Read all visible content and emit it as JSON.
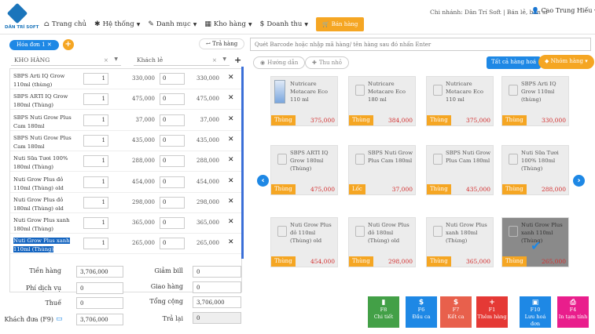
{
  "logo": {
    "text": "DÂN TRÍ SOFT"
  },
  "nav": [
    {
      "icon": "home-icon",
      "glyph": "⌂",
      "label": "Trang chủ",
      "caret": false
    },
    {
      "icon": "gear-icon",
      "glyph": "✱",
      "label": "Hệ thống",
      "caret": true
    },
    {
      "icon": "wrench-icon",
      "glyph": "✎",
      "label": "Danh mục",
      "caret": true
    },
    {
      "icon": "warehouse-icon",
      "glyph": "▦",
      "label": "Kho hàng",
      "caret": true
    },
    {
      "icon": "dollar-icon",
      "glyph": "$",
      "label": "Doanh thu",
      "caret": true
    }
  ],
  "sale_button": "Bán hàng",
  "branch": "Chi nhánh: Dân Trí Soft | Bán lẻ, bán sỉ",
  "user": "Cao Trung Hiếu",
  "order_tab": "Hóa đơn 1",
  "return_button": "Trả hàng",
  "warehouse_select": "KHO HÀNG",
  "customer_select": "Khách lẻ",
  "cart": [
    {
      "name": "SBPS Arti IQ Grow 110ml (thùng)",
      "qty": "1",
      "price": "330,000",
      "discount": "0",
      "total": "330,000"
    },
    {
      "name": "SBPS ARTI IQ Grow 180ml (Thùng)",
      "qty": "1",
      "price": "475,000",
      "discount": "0",
      "total": "475,000"
    },
    {
      "name": "SBPS Nuti Grow Plus Cam 180ml",
      "qty": "1",
      "price": "37,000",
      "discount": "0",
      "total": "37,000"
    },
    {
      "name": "SBPS Nuti Grow Plus Cam 180ml",
      "qty": "1",
      "price": "435,000",
      "discount": "0",
      "total": "435,000"
    },
    {
      "name": "Nuti Sữa Tươi 100% 180ml (Thùng)",
      "qty": "1",
      "price": "288,000",
      "discount": "0",
      "total": "288,000"
    },
    {
      "name": "Nuti Grow Plus đỏ 110ml (Thùng) old",
      "qty": "1",
      "price": "454,000",
      "discount": "0",
      "total": "454,000"
    },
    {
      "name": "Nuti Grow Plus đỏ 180ml (Thùng) old",
      "qty": "1",
      "price": "298,000",
      "discount": "0",
      "total": "298,000"
    },
    {
      "name": "Nuti Grow Plus xanh 180ml (Thùng)",
      "qty": "1",
      "price": "365,000",
      "discount": "0",
      "total": "365,000"
    },
    {
      "name": "Nuti Grow Plus xanh 110ml (Thùng)",
      "qty": "1",
      "price": "265,000",
      "discount": "0",
      "total": "265,000"
    }
  ],
  "summary": {
    "subtotal_label": "Tiền hàng",
    "subtotal": "3,706,000",
    "service_label": "Phí dịch vụ",
    "service": "0",
    "tax_label": "Thuế",
    "tax": "0",
    "paid_label": "Khách đưa (F9)",
    "paid": "3,706,000",
    "bill_discount_label": "Giảm bill",
    "bill_discount": "0",
    "delivery_label": "Giao hàng",
    "delivery": "0",
    "grand_total_label": "Tổng cộng",
    "grand_total": "3,706,000",
    "change_label": "Trả lại",
    "change": "0"
  },
  "search_placeholder": "Quét Barcode hoặc nhập mã hàng/ tên hàng sau đó nhấn Enter",
  "guide_button": "Hướng dẫn",
  "shrink_button": "Thu nhỏ",
  "all_products_button": "Tất cả hàng hoá",
  "product_group_button": "Nhóm hàng",
  "products": [
    {
      "name": "Nutricare Metacare Eco 110 ml",
      "unit": "Thùng",
      "price": "375,000",
      "image": true
    },
    {
      "name": "Nutricare Metacare Eco 180 ml",
      "unit": "Thùng",
      "price": "384,000"
    },
    {
      "name": "Nutricare Metacare Eco 110 ml",
      "unit": "Thùng",
      "price": "375,000"
    },
    {
      "name": "SBPS Arti IQ Grow 110ml (thùng)",
      "unit": "Thùng",
      "price": "330,000"
    },
    {
      "name": "SBPS ARTI IQ Grow 180ml (Thùng)",
      "unit": "Thùng",
      "price": "475,000"
    },
    {
      "name": "SBPS Nuti Grow Plus Cam 180ml",
      "unit": "Lốc",
      "price": "37,000"
    },
    {
      "name": "SBPS Nuti Grow Plus Cam 180ml",
      "unit": "Thùng",
      "price": "435,000"
    },
    {
      "name": "Nuti Sữa Tươi 100% 180ml (Thùng)",
      "unit": "Thùng",
      "price": "288,000"
    },
    {
      "name": "Nuti Grow Plus đỏ 110ml (Thùng) old",
      "unit": "Thùng",
      "price": "454,000"
    },
    {
      "name": "Nuti Grow Plus đỏ 180ml (Thùng) old",
      "unit": "Thùng",
      "price": "298,000"
    },
    {
      "name": "Nuti Grow Plus xanh 180ml (Thùng)",
      "unit": "Thùng",
      "price": "365,000"
    },
    {
      "name": "Nuti Grow Plus xanh 110ml (Thùng)",
      "unit": "Thùng",
      "price": "265,000",
      "selected": true
    }
  ],
  "functions": [
    {
      "key": "F8",
      "label": "Chi tiết",
      "color": "#43a047",
      "icon": "file-icon",
      "glyph": "▮"
    },
    {
      "key": "F6",
      "label": "Đầu ca",
      "color": "#1e88e5",
      "icon": "dollar-icon",
      "glyph": "$"
    },
    {
      "key": "F7",
      "label": "Kết ca",
      "color": "#e8604c",
      "icon": "dollar-icon",
      "glyph": "$"
    },
    {
      "key": "F1",
      "label": "Thêm hàng",
      "color": "#e53935",
      "icon": "plus-circle-icon",
      "glyph": "+"
    },
    {
      "key": "F10",
      "label": "Lưu hoá đơn",
      "color": "#1e88e5",
      "icon": "save-icon",
      "glyph": "▣"
    },
    {
      "key": "F4",
      "label": "In tạm tính",
      "color": "#e91e8c",
      "icon": "print-icon",
      "glyph": "⎙"
    }
  ]
}
